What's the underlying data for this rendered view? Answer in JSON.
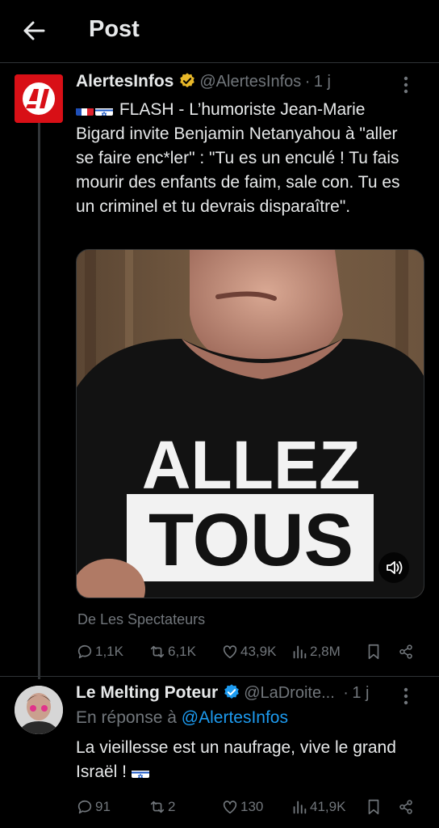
{
  "header": {
    "title": "Post",
    "back_icon": "arrow-left-icon"
  },
  "main_tweet": {
    "author_name": "AlertesInfos",
    "handle": "@AlertesInfos",
    "separator": "·",
    "time": "1 j",
    "verified": true,
    "avatar_logo_text": "AI",
    "flags": [
      "france-flag",
      "israel-flag"
    ],
    "text": "FLASH - L’humoriste Jean-Marie Bigard invite Benjamin Netanyahou à \"aller se faire enc*ler\" : \"Tu es un enculé ! Tu fais mourir des enfants de faim, sale con. Tu es un criminel et tu devrais disparaître\".",
    "video_shirt_text": [
      "ALLEZ",
      "TOUS"
    ],
    "source": "De Les Spectateurs",
    "stats": {
      "replies": "1,1K",
      "reposts": "6,1K",
      "likes": "43,9K",
      "views": "2,8M"
    }
  },
  "reply_tweet": {
    "author_name": "Le Melting Poteur",
    "handle": "@LaDroite...",
    "separator": "·",
    "time": "1 j",
    "verified": true,
    "in_reply_prefix": "En réponse à",
    "in_reply_to": "@AlertesInfos",
    "text": "La vieillesse est un naufrage, vive le grand Israël !",
    "flags": [
      "israel-flag"
    ],
    "stats": {
      "replies": "91",
      "reposts": "2",
      "likes": "130",
      "views": "41,9K"
    }
  },
  "colors": {
    "background": "#000000",
    "text": "#e7e9ea",
    "muted": "#71767b",
    "link": "#1d9bf0",
    "verified": "#e8b829",
    "divider": "#2f3336"
  }
}
